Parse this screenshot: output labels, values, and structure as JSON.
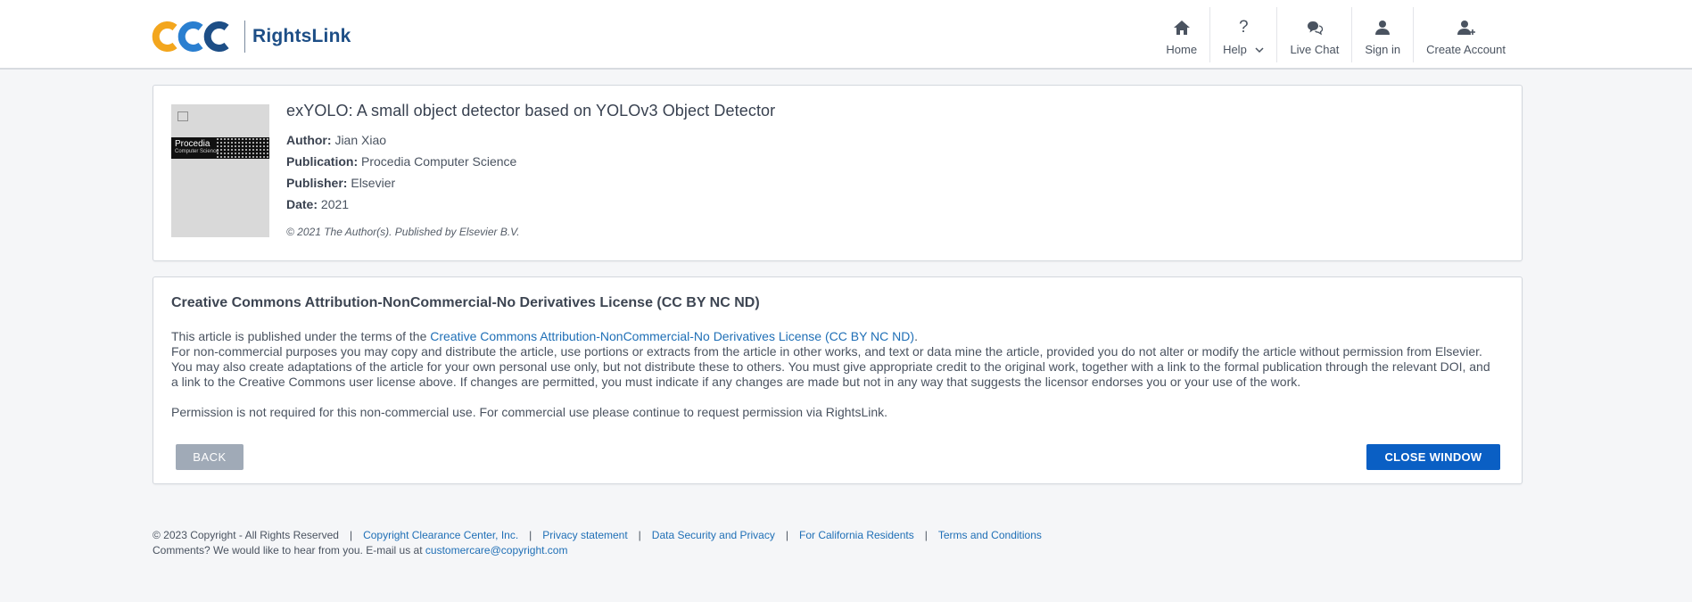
{
  "header": {
    "brand_name": "RightsLink",
    "logo_colors": [
      "#f3a61d",
      "#1d4e86"
    ],
    "nav": [
      {
        "label": "Home",
        "icon": "home-icon"
      },
      {
        "label": "Help",
        "icon": "help-icon"
      },
      {
        "label": "Live Chat",
        "icon": "chat-icon"
      },
      {
        "label": "Sign in",
        "icon": "user-icon"
      },
      {
        "label": "Create Account",
        "icon": "add-user-icon"
      }
    ],
    "help_glyph": "?"
  },
  "article": {
    "title": "exYOLO: A small object detector based on YOLOv3 Object Detector",
    "author_label": "Author:",
    "author": "Jian Xiao",
    "publication_label": "Publication:",
    "publication": "Procedia Computer Science",
    "publisher_label": "Publisher:",
    "publisher": "Elsevier",
    "date_label": "Date:",
    "date": "2021",
    "copyright": "© 2021 The Author(s). Published by Elsevier B.V.",
    "cover": {
      "title": "Procedia",
      "subtitle": "Computer Science"
    }
  },
  "license": {
    "title": "Creative Commons Attribution-NonCommercial-No Derivatives License (CC BY NC ND)",
    "intro": "This article is published under the terms of the ",
    "link_text": "Creative Commons Attribution-NonCommercial-No Derivatives License (CC BY NC ND)",
    "intro_end": ".",
    "body": "For non-commercial purposes you may copy and distribute the article, use portions or extracts from the article in other works, and text or data mine the article, provided you do not alter or modify the article without permission from Elsevier. You may also create adaptations of the article for your own personal use only, but not distribute these to others. You must give appropriate credit to the original work, together with a link to the formal publication through the relevant DOI, and a link to the Creative Commons user license above. If changes are permitted, you must indicate if any changes are made but not in any way that suggests the licensor endorses you or your use of the work.",
    "permission": "Permission is not required for this non-commercial use. For commercial use please continue to request permission via RightsLink.",
    "back_label": "BACK",
    "close_label": "CLOSE WINDOW"
  },
  "footer": {
    "copyright": "© 2023 Copyright - All Rights Reserved",
    "separator": "|",
    "links": [
      "Copyright Clearance Center, Inc.",
      "Privacy statement",
      "Data Security and Privacy",
      "For California Residents",
      "Terms and Conditions"
    ],
    "comments": "Comments? We would like to hear from you. E-mail us at ",
    "email": "customercare@copyright.com"
  },
  "colors": {
    "link": "#1f6fb6",
    "primary_button": "#0a5fc4",
    "secondary_button": "#a0aab7"
  }
}
